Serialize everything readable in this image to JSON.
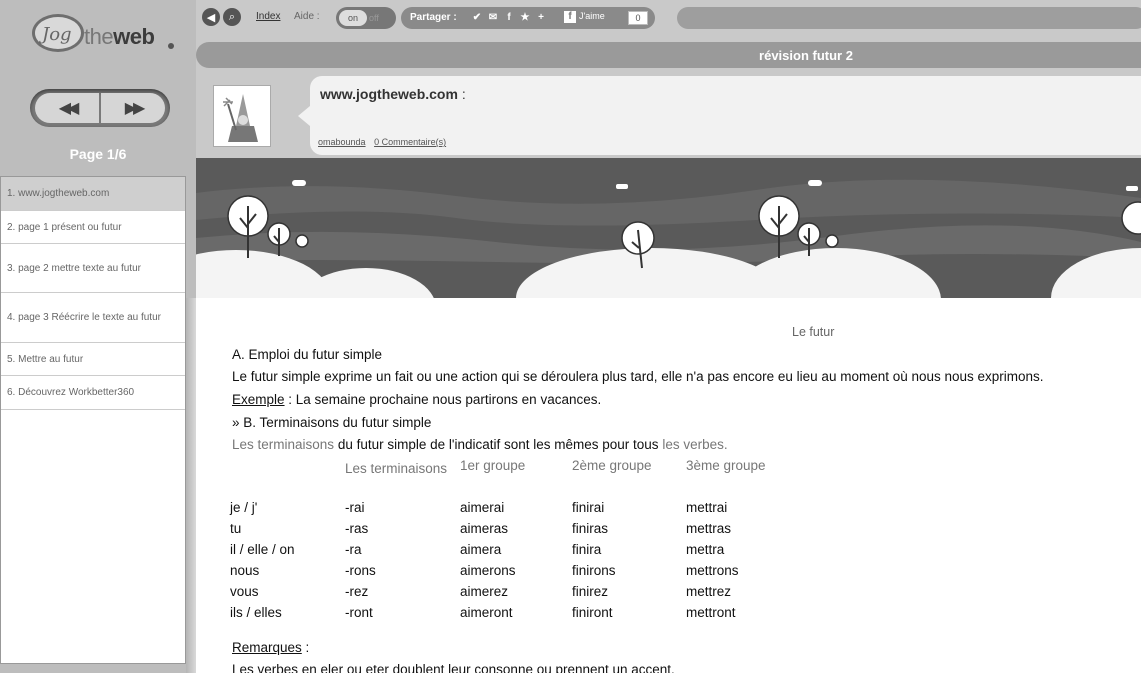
{
  "logo": {
    "jog": "Jog",
    "the": "the",
    "web": "web"
  },
  "nav": {
    "prev_icon": "rewind-icon",
    "next_icon": "fast-forward-icon"
  },
  "page_indicator": "Page 1/6",
  "toc": [
    "1. www.jogtheweb.com",
    "2. page 1 présent ou futur",
    "3. page 2 mettre texte au futur",
    "4. page 3 Réécrire le texte au futur",
    "5. Mettre au futur",
    "6. Découvrez Workbetter360"
  ],
  "topbar": {
    "index": "Index",
    "aide": "Aide :",
    "toggle_on": "on",
    "toggle_off": "off",
    "share": "Partager :",
    "like": "J'aime",
    "like_count": "0"
  },
  "title": "révision futur 2",
  "card": {
    "url": "www.jogtheweb.com",
    "colon": " :",
    "author": "omabounda",
    "comments": "0 Commentaire(s)"
  },
  "content": {
    "heading": "Le futur",
    "section_a": "A. Emploi du futur simple",
    "para_a": "Le futur simple exprime un fait ou une action qui se déroulera plus tard, elle n'a pas encore eu lieu au moment où nous nous exprimons.",
    "exemple_label": "Exemple",
    "exemple_text": " : La semaine prochaine nous partirons en vacances.",
    "section_b": "» B. Terminaisons du futur simple",
    "terms_p1": "Les terminaisons",
    "terms_p2": " du futur simple de l'indicatif sont les mêmes pour ",
    "terms_p3": "tous",
    "terms_p4": " les verbes.",
    "table_headers": [
      "",
      "Les terminaisons",
      "1er groupe",
      "2ème groupe",
      "3ème groupe"
    ],
    "table_rows": [
      [
        "je / j'",
        "-rai",
        "aimerai",
        "finirai",
        "mettrai"
      ],
      [
        "tu",
        "-ras",
        "aimeras",
        "finiras",
        "mettras"
      ],
      [
        "il / elle / on",
        "-ra",
        "aimera",
        "finira",
        "mettra"
      ],
      [
        "nous",
        "-rons",
        "aimerons",
        "finirons",
        "mettrons"
      ],
      [
        "vous",
        "-rez",
        "aimerez",
        "finirez",
        "mettrez"
      ],
      [
        "ils / elles",
        "-ront",
        "aimeront",
        "finiront",
        "mettront"
      ]
    ],
    "remarques_label": "Remarques",
    "remarques_colon": " :",
    "last_line": "Les verbes en eler ou eter doublent leur consonne ou prennent un accent."
  }
}
